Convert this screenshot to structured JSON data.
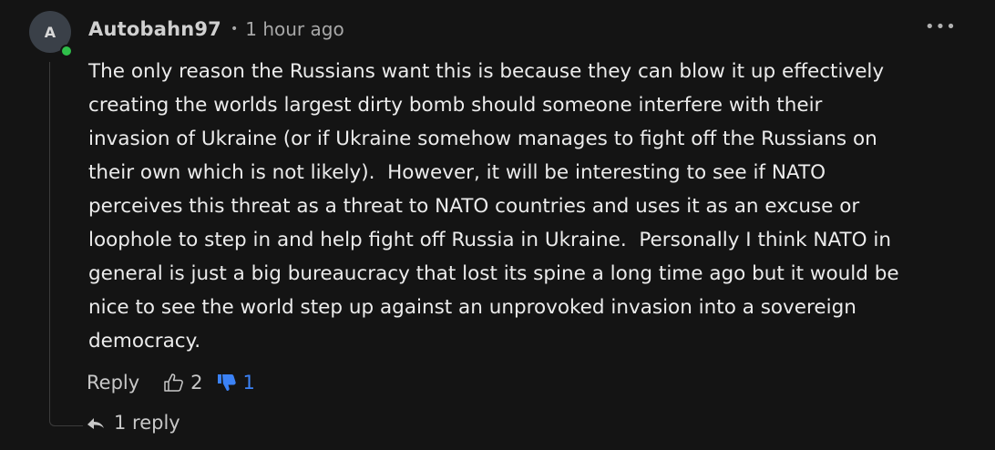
{
  "comment": {
    "avatar_initial": "A",
    "username": "Autobahn97",
    "separator": "•",
    "timestamp": "1 hour ago",
    "more_label": "•••",
    "body_lines": [
      "The only reason the Russians want this is because they can blow it up effectively",
      "creating the worlds largest dirty bomb should someone interfere with their",
      "invasion of Ukraine (or if Ukraine somehow manages to fight off the Russians on",
      "their own which is not likely).  However, it will be interesting to see if NATO",
      "perceives this threat as a threat to NATO countries and uses it as an excuse or",
      "loophole to step in and help fight off Russia in Ukraine.  Personally I think NATO in",
      "general is just a big bureaucracy that lost its spine a long time ago but it would be",
      "nice to see the world step up against an unprovoked invasion into a sovereign",
      "democracy."
    ],
    "actions": {
      "reply_label": "Reply",
      "upvotes": "2",
      "downvotes": "1"
    },
    "replies_label": "1 reply"
  },
  "colors": {
    "background": "#141414",
    "online": "#2fbf4a",
    "downvote_active": "#3b82f6"
  },
  "icons": {
    "upvote": "thumbs-up-outline-icon",
    "downvote": "thumbs-down-filled-icon",
    "reply_arrow": "reply-arrow-icon",
    "more": "more-options-icon"
  }
}
